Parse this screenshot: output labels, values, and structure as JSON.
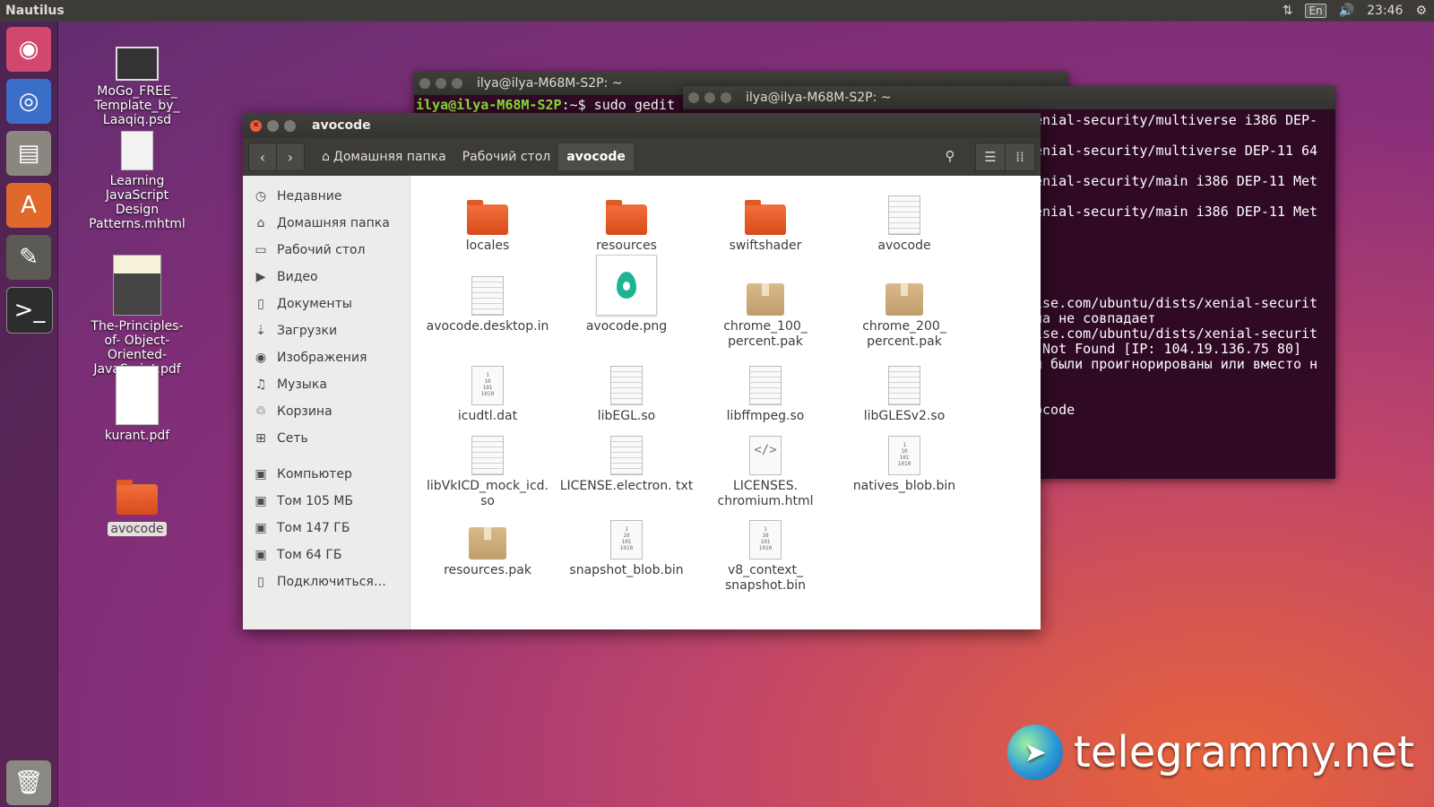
{
  "topbar": {
    "app_title": "Nautilus",
    "keyboard": "En",
    "time": "23:46"
  },
  "desktop_icons": [
    {
      "label": "MoGo_FREE_ Template_by_ Laaqiq.psd"
    },
    {
      "label": "Learning JavaScript Design Patterns.mhtml"
    },
    {
      "label": "The-Principles-of- Object-Oriented- JavaScript.pdf"
    },
    {
      "label": "kurant.pdf"
    },
    {
      "label": "avocode"
    }
  ],
  "terminal_back": {
    "title": "ilya@ilya-M68M-S2P: ~",
    "prompt_user": "ilya@ilya-M68M-S2P",
    "prompt_rest": ":~$ sudo gedit"
  },
  "terminal_front": {
    "title": "ilya@ilya-M68M-S2P: ~",
    "lines": [
      "enial-security/multiverse i386 DEP-",
      "",
      "enial-security/multiverse DEP-11 64",
      "",
      "enial-security/main i386 DEP-11 Met",
      "",
      "enial-security/main i386 DEP-11 Met",
      "",
      "",
      "",
      "",
      "",
      "ise.com/ubuntu/dists/xenial-securit",
      "на не совпадает",
      "ise.com/ubuntu/dists/xenial-securit",
      " Not Found [IP: 104.19.136.75 80]",
      "и были проигнорированы или вместо н",
      "",
      "",
      "ocode"
    ]
  },
  "nautilus": {
    "title": "avocode",
    "breadcrumbs": [
      "Домашняя папка",
      "Рабочий стол",
      "avocode"
    ],
    "sidebar_top": [
      {
        "label": "Недавние",
        "icon": "clock-icon"
      },
      {
        "label": "Домашняя папка",
        "icon": "home-icon"
      },
      {
        "label": "Рабочий стол",
        "icon": "desktop-icon"
      },
      {
        "label": "Видео",
        "icon": "video-icon"
      },
      {
        "label": "Документы",
        "icon": "document-icon"
      },
      {
        "label": "Загрузки",
        "icon": "download-icon"
      },
      {
        "label": "Изображения",
        "icon": "camera-icon"
      },
      {
        "label": "Музыка",
        "icon": "music-icon"
      },
      {
        "label": "Корзина",
        "icon": "trash-icon"
      },
      {
        "label": "Сеть",
        "icon": "network-icon"
      }
    ],
    "sidebar_bottom": [
      {
        "label": "Компьютер",
        "icon": "drive-icon"
      },
      {
        "label": "Том 105 МБ",
        "icon": "drive-icon"
      },
      {
        "label": "Том 147 ГБ",
        "icon": "drive-icon"
      },
      {
        "label": "Том 64 ГБ",
        "icon": "drive-icon"
      },
      {
        "label": "Подключиться…",
        "icon": "server-icon"
      }
    ],
    "files": [
      {
        "name": "locales",
        "type": "folder"
      },
      {
        "name": "resources",
        "type": "folder"
      },
      {
        "name": "swiftshader",
        "type": "folder"
      },
      {
        "name": "avocode",
        "type": "text"
      },
      {
        "name": "avocode.desktop.in",
        "type": "text"
      },
      {
        "name": "avocode.png",
        "type": "image"
      },
      {
        "name": "chrome_100_ percent.pak",
        "type": "package"
      },
      {
        "name": "chrome_200_ percent.pak",
        "type": "package"
      },
      {
        "name": "icudtl.dat",
        "type": "binary"
      },
      {
        "name": "libEGL.so",
        "type": "text"
      },
      {
        "name": "libffmpeg.so",
        "type": "text"
      },
      {
        "name": "libGLESv2.so",
        "type": "text"
      },
      {
        "name": "libVkICD_mock_icd. so",
        "type": "text"
      },
      {
        "name": "LICENSE.electron. txt",
        "type": "text"
      },
      {
        "name": "LICENSES. chromium.html",
        "type": "html"
      },
      {
        "name": "natives_blob.bin",
        "type": "binary"
      },
      {
        "name": "resources.pak",
        "type": "package"
      },
      {
        "name": "snapshot_blob.bin",
        "type": "binary"
      },
      {
        "name": "v8_context_ snapshot.bin",
        "type": "binary"
      }
    ]
  },
  "watermark": {
    "text": "telegrammy.net"
  },
  "colors": {
    "accent": "#e95420",
    "terminal_bg": "#300a24",
    "topbar": "#3c3b37"
  }
}
